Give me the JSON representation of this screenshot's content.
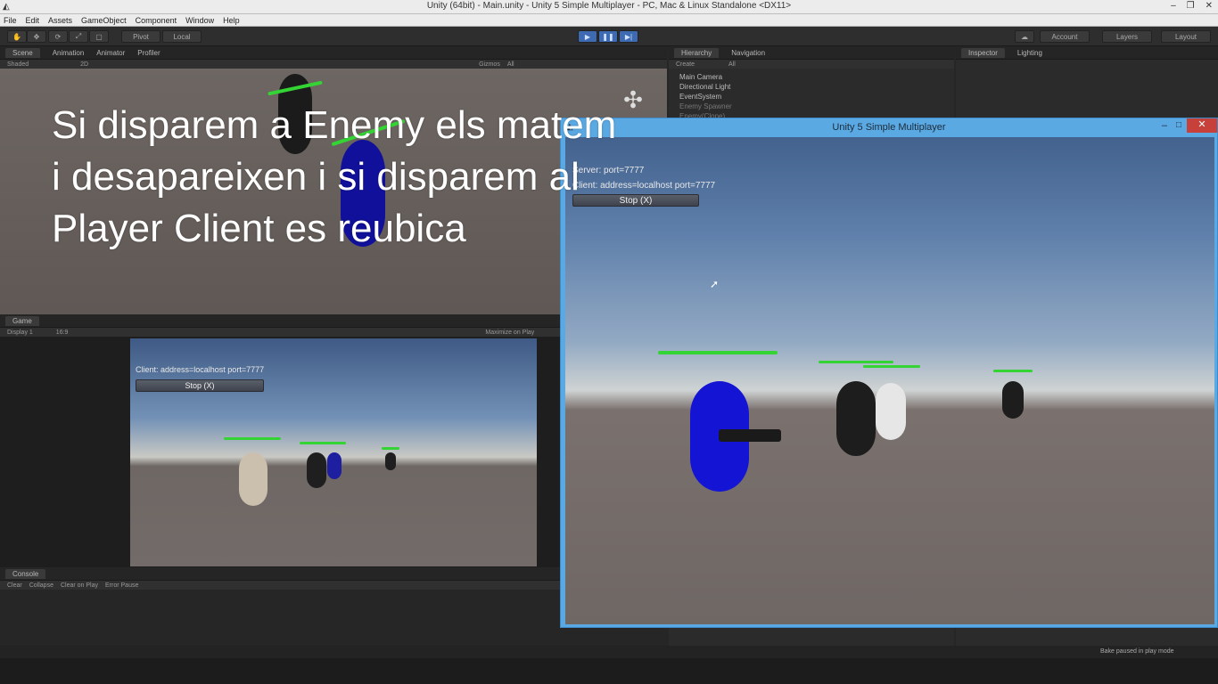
{
  "window": {
    "title": "Unity (64bit) - Main.unity - Unity 5 Simple Multiplayer - PC, Mac & Linux Standalone <DX11>"
  },
  "menu": [
    "File",
    "Edit",
    "Assets",
    "GameObject",
    "Component",
    "Window",
    "Help"
  ],
  "toolbar": {
    "pivot": "Pivot",
    "local": "Local",
    "account": "Account",
    "layers": "Layers",
    "layout": "Layout"
  },
  "scene": {
    "tabs": [
      "Scene",
      "Animation",
      "Animator",
      "Profiler"
    ],
    "shaded": "Shaded",
    "mode2d": "2D",
    "gizmos": "Gizmos",
    "search": "All"
  },
  "game": {
    "tab": "Game",
    "display": "Display 1",
    "aspect": "16:9",
    "maximize": "Maximize on Play",
    "client_text": "Client: address=localhost port=7777",
    "stop": "Stop (X)"
  },
  "console": {
    "tab": "Console",
    "buttons": [
      "Clear",
      "Collapse",
      "Clear on Play",
      "Error Pause"
    ]
  },
  "hierarchy": {
    "tabs": [
      "Hierarchy",
      "Navigation"
    ],
    "create": "Create",
    "search": "All",
    "items": [
      "Main Camera",
      "Directional Light",
      "EventSystem",
      "Enemy Spawner",
      "Enemy(Clone)"
    ]
  },
  "inspector": {
    "tabs": [
      "Inspector",
      "Lighting"
    ]
  },
  "status": {
    "bake": "Bake paused in play mode"
  },
  "caption": {
    "text": "Si disparem a Enemy els matem i desapareixen i si disparem al Player Client es reubica"
  },
  "player": {
    "title": "Unity 5 Simple Multiplayer",
    "server_text": "Server: port=7777",
    "client_text": "Client: address=localhost port=7777",
    "stop": "Stop (X)"
  },
  "icons": {
    "close": "close-icon",
    "minimize": "minimize-icon",
    "maximize": "maximize-icon",
    "unity": "unity-logo-icon"
  }
}
